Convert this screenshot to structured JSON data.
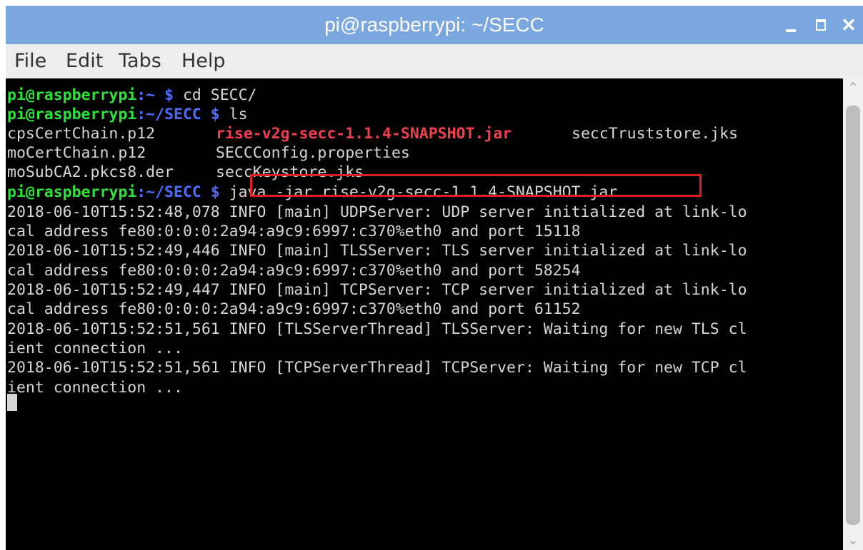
{
  "window": {
    "title": "pi@raspberrypi: ~/SECC",
    "controls": {
      "minimize": "minimize-icon",
      "maximize": "maximize-icon",
      "close": "✕"
    }
  },
  "menu": [
    "File",
    "Edit",
    "Tabs",
    "Help"
  ],
  "terminal": {
    "prompt1": {
      "user": "pi@raspberrypi",
      "path": ":~ $",
      "cmd": " cd SECC/"
    },
    "prompt2": {
      "user": "pi@raspberrypi",
      "path": ":~/SECC $",
      "cmd": " ls"
    },
    "ls": {
      "row1": {
        "a": "cpsCertChain.p12",
        "b": "rise-v2g-secc-1.1.4-SNAPSHOT.jar",
        "c": "seccTruststore.jks"
      },
      "row2": {
        "a": "moCertChain.p12",
        "b": "SECCConfig.properties"
      },
      "row3": {
        "a": "moSubCA2.pkcs8.der",
        "b": "seccKeystore.jks"
      }
    },
    "prompt3": {
      "user": "pi@raspberrypi",
      "path": ":~/SECC $",
      "cmd": " java -jar rise-v2g-secc-1.1.4-SNAPSHOT.jar"
    },
    "log": [
      "2018-06-10T15:52:48,078 INFO [main] UDPServer: UDP server initialized at link-lo",
      "cal address fe80:0:0:0:2a94:a9c9:6997:c370%eth0 and port 15118",
      "2018-06-10T15:52:49,446 INFO [main] TLSServer: TLS server initialized at link-lo",
      "cal address fe80:0:0:0:2a94:a9c9:6997:c370%eth0 and port 58254",
      "2018-06-10T15:52:49,447 INFO [main] TCPServer: TCP server initialized at link-lo",
      "cal address fe80:0:0:0:2a94:a9c9:6997:c370%eth0 and port 61152",
      "2018-06-10T15:52:51,561 INFO [TLSServerThread] TLSServer: Waiting for new TLS cl",
      "ient connection ...",
      "2018-06-10T15:52:51,561 INFO [TCPServerThread] TCPServer: Waiting for new TCP cl",
      "ient connection ..."
    ]
  },
  "colors": {
    "titlebar": "#7aa7e0",
    "prompt_user": "#2fe23a",
    "prompt_path": "#4f6cff",
    "highlight_file": "#f04050",
    "annotation_box": "#e02020"
  }
}
